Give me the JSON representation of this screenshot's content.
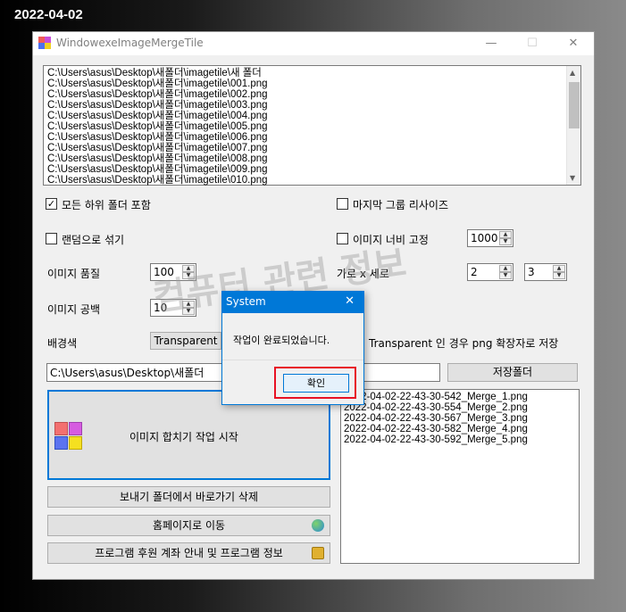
{
  "date_overlay": "2022-04-02",
  "window": {
    "title": "WindowexeImageMergeTile",
    "minimize": "—",
    "maximize": "☐",
    "close": "✕"
  },
  "file_list": [
    "C:\\Users\\asus\\Desktop\\새폴더\\imagetile\\새 폴더",
    "C:\\Users\\asus\\Desktop\\새폴더\\imagetile\\001.png",
    "C:\\Users\\asus\\Desktop\\새폴더\\imagetile\\002.png",
    "C:\\Users\\asus\\Desktop\\새폴더\\imagetile\\003.png",
    "C:\\Users\\asus\\Desktop\\새폴더\\imagetile\\004.png",
    "C:\\Users\\asus\\Desktop\\새폴더\\imagetile\\005.png",
    "C:\\Users\\asus\\Desktop\\새폴더\\imagetile\\006.png",
    "C:\\Users\\asus\\Desktop\\새폴더\\imagetile\\007.png",
    "C:\\Users\\asus\\Desktop\\새폴더\\imagetile\\008.png",
    "C:\\Users\\asus\\Desktop\\새폴더\\imagetile\\009.png",
    "C:\\Users\\asus\\Desktop\\새폴더\\imagetile\\010.png"
  ],
  "options": {
    "include_subfolders": {
      "label": "모든 하위 폴더 포함",
      "checked": true
    },
    "resize_last_group": {
      "label": "마지막 그룹 리사이즈",
      "checked": false
    },
    "shuffle_random": {
      "label": "랜덤으로 섞기",
      "checked": false
    },
    "fix_image_width": {
      "label": "이미지 너비 고정",
      "checked": false
    },
    "fixed_width_value": "1000",
    "quality_label": "이미지 품질",
    "quality_value": "100",
    "cols_rows_label": "가로 x 세로",
    "cols_value": "2",
    "rows_value": "3",
    "spacing_label": "이미지 공백",
    "spacing_value": "10",
    "bg_label": "배경색",
    "bg_value": "Transparent",
    "transparent_note": "Transparent 인 경우 png 확장자로 저장"
  },
  "save_path": "C:\\Users\\asus\\Desktop\\새폴더",
  "save_folder_button": "저장폴더",
  "start_button": "이미지 합치기 작업 시작",
  "delete_shortcut_button": "보내기 폴더에서 바로가기 삭제",
  "homepage_button": "홈페이지로 이동",
  "donation_button": "프로그램 후원 계좌 안내 및 프로그램 정보",
  "output_files": [
    "2022-04-02-22-43-30-542_Merge_1.png",
    "2022-04-02-22-43-30-554_Merge_2.png",
    "2022-04-02-22-43-30-567_Merge_3.png",
    "2022-04-02-22-43-30-582_Merge_4.png",
    "2022-04-02-22-43-30-592_Merge_5.png"
  ],
  "dialog": {
    "title": "System",
    "close": "✕",
    "message": "작업이 완료되었습니다.",
    "ok": "확인"
  },
  "watermark": "컴퓨터 관련 정보",
  "colors": {
    "accent": "#0078d7",
    "highlight_red": "#e81123"
  }
}
